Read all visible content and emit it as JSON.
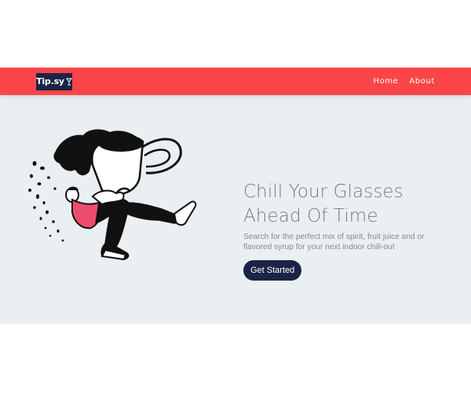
{
  "colors": {
    "nav_background": "#fc4548",
    "hero_background": "#eaeff2",
    "brand_navy": "#1b2447",
    "figure_pink": "#ee4d6f"
  },
  "navbar": {
    "logo_text": "Tip.sy",
    "links": [
      "Home",
      "About"
    ]
  },
  "hero": {
    "title_line1": "Chill Your Glasses",
    "title_line2": "Ahead Of Time",
    "subtitle": "Search for the perfect mix of spirit, fruit juice and or flavored syrup for your next indoor chill-out",
    "cta_label": "Get Started"
  }
}
